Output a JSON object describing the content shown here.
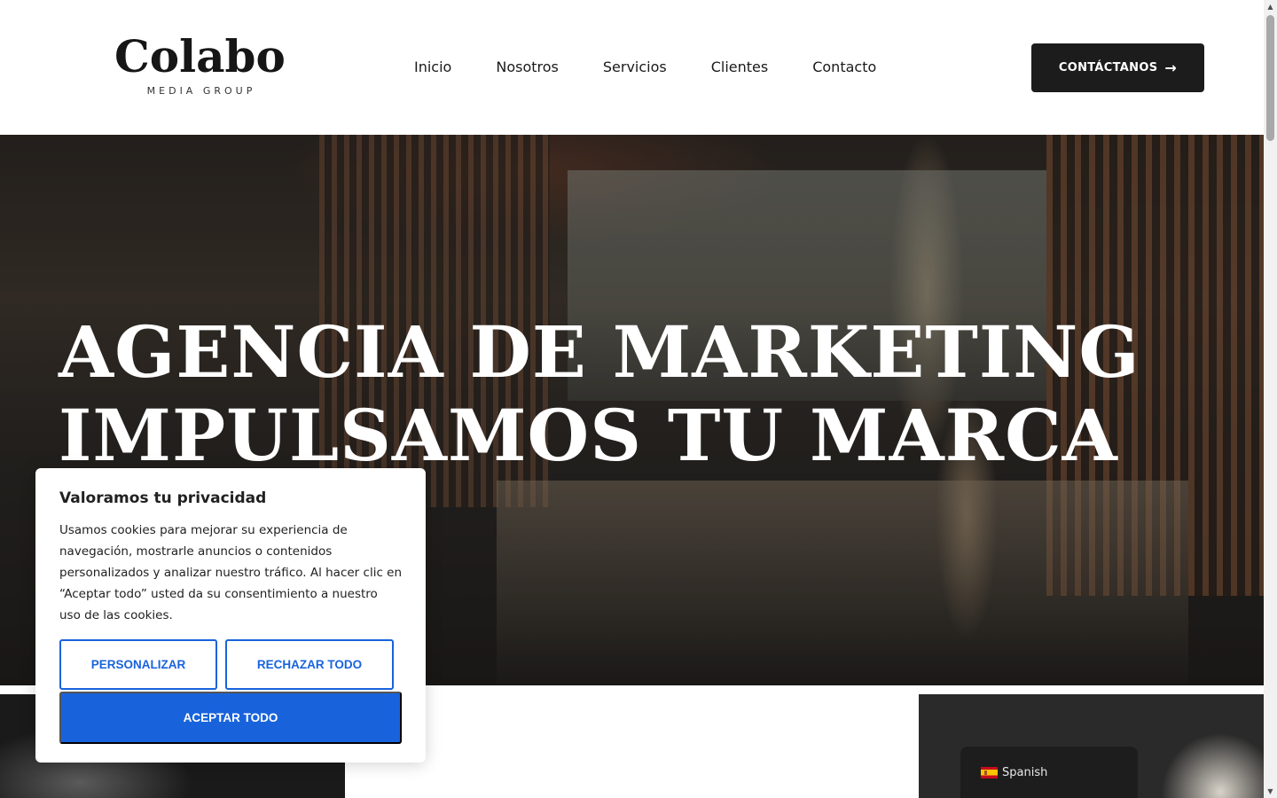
{
  "header": {
    "logo_main": "Colabo",
    "logo_sub": "MEDIA GROUP",
    "nav": [
      "Inicio",
      "Nosotros",
      "Servicios",
      "Clientes",
      "Contacto"
    ],
    "cta_label": "CONTÁCTANOS",
    "cta_icon": "arrow-right-icon"
  },
  "hero": {
    "title_line1": "AGENCIA DE MARKETING",
    "title_line2": "IMPULSAMOS TU MARCA"
  },
  "cookie_banner": {
    "title": "Valoramos tu privacidad",
    "body": "Usamos cookies para mejorar su experiencia de navegación, mostrarle anuncios o contenidos personalizados y analizar nuestro tráfico. Al hacer clic en “Aceptar todo” usted da su consentimiento a nuestro uso de las cookies.",
    "customize_label": "PERSONALIZAR",
    "reject_label": "RECHAZAR TODO",
    "accept_label": "ACEPTAR TODO",
    "accent_color": "#1863dc"
  },
  "language_switcher": {
    "label": "Spanish",
    "flag_icon": "spain-flag-icon"
  }
}
